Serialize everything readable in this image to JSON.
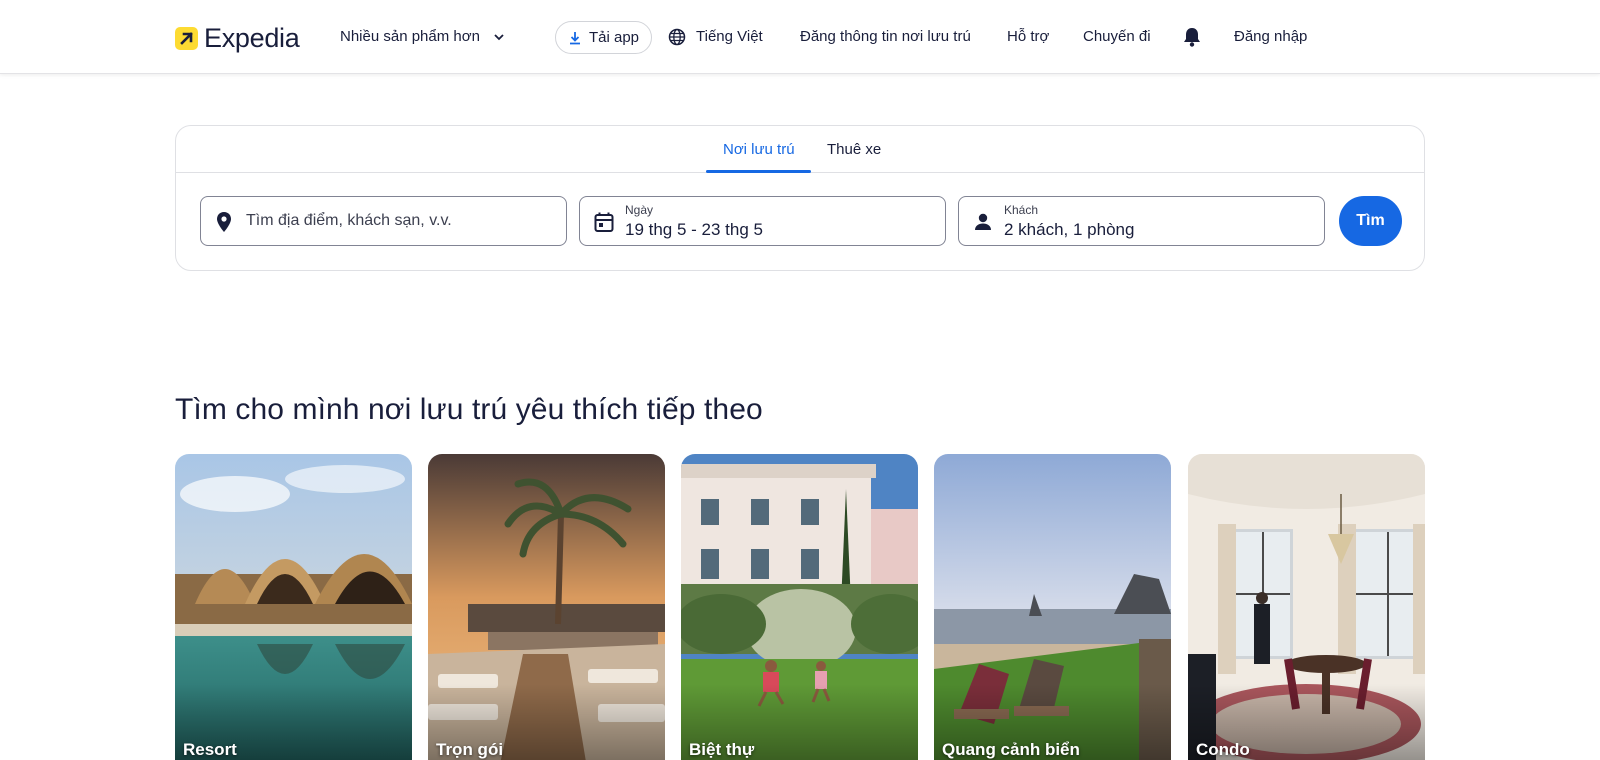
{
  "header": {
    "logo_text": "Expedia",
    "more_products": "Nhiều sản phẩm hơn",
    "get_app": "Tải app",
    "language": "Tiếng Việt",
    "list_property": "Đăng thông tin nơi lưu trú",
    "support": "Hỗ trợ",
    "trips": "Chuyến đi",
    "sign_in": "Đăng nhập"
  },
  "search": {
    "tabs": [
      {
        "label": "Nơi lưu trú",
        "active": true
      },
      {
        "label": "Thuê xe",
        "active": false
      }
    ],
    "destination_placeholder": "Tìm địa điểm, khách sạn, v.v.",
    "dates_label": "Ngày",
    "dates_value": "19 thg 5 - 23 thg 5",
    "travelers_label": "Khách",
    "travelers_value": "2 khách, 1 phòng",
    "search_button": "Tìm"
  },
  "section": {
    "title": "Tìm cho mình nơi lưu trú yêu thích tiếp theo",
    "cards": [
      {
        "label": "Resort"
      },
      {
        "label": "Trọn gói"
      },
      {
        "label": "Biệt thự"
      },
      {
        "label": "Quang cảnh biển"
      },
      {
        "label": "Condo"
      }
    ]
  },
  "colors": {
    "accent": "#1668e3",
    "brand_yellow": "#fddb32",
    "text_dark": "#191e3b"
  }
}
